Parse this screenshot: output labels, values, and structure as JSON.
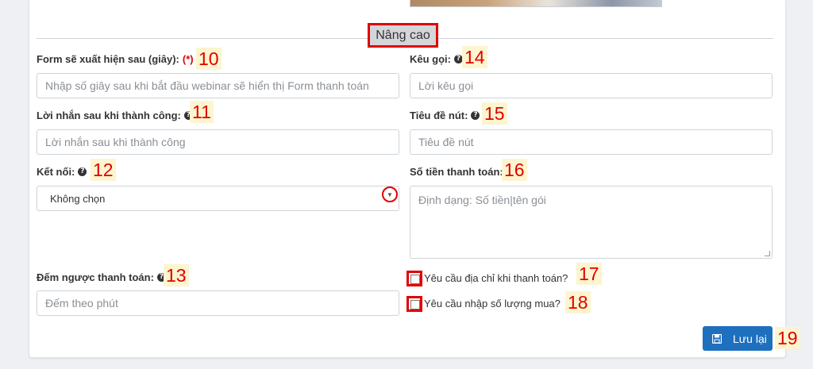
{
  "section": {
    "title": "Nâng cao"
  },
  "left": {
    "form_delay": {
      "label": "Form sẽ xuất hiện sau (giây):",
      "required": "(*)",
      "number": "10",
      "placeholder": "Nhập số giây sau khi bắt đầu webinar sẽ hiển thị Form thanh toán"
    },
    "success_message": {
      "label": "Lời nhắn sau khi thành công:",
      "number": "11",
      "placeholder": "Lời nhắn sau khi thành công"
    },
    "connection": {
      "label": "Kết nối:",
      "number": "12",
      "selected": "Không chọn"
    },
    "countdown": {
      "label": "Đếm ngược thanh toán:",
      "number": "13",
      "placeholder": "Đếm theo phút"
    }
  },
  "right": {
    "call_to_action": {
      "label": "Kêu gọi:",
      "number": "14",
      "placeholder": "Lời kêu gọi"
    },
    "button_title": {
      "label": "Tiêu đề nút:",
      "number": "15",
      "placeholder": "Tiêu đề nút"
    },
    "payment_amount": {
      "label": "Số tiền thanh toán:",
      "number": "16",
      "placeholder": "Định dạng: Số tiền|tên gói"
    },
    "require_address": {
      "label": "Yêu cầu địa chỉ khi thanh toán?",
      "number": "17",
      "checked": false
    },
    "require_quantity": {
      "label": "Yêu cầu nhập số lượng mua?",
      "number": "18",
      "checked": false
    }
  },
  "save": {
    "label": "Lưu lại",
    "number": "19"
  },
  "colors": {
    "accent": "#e10000",
    "primary_button": "#1f6fbf",
    "marker_bg": "#fcf5cf"
  }
}
